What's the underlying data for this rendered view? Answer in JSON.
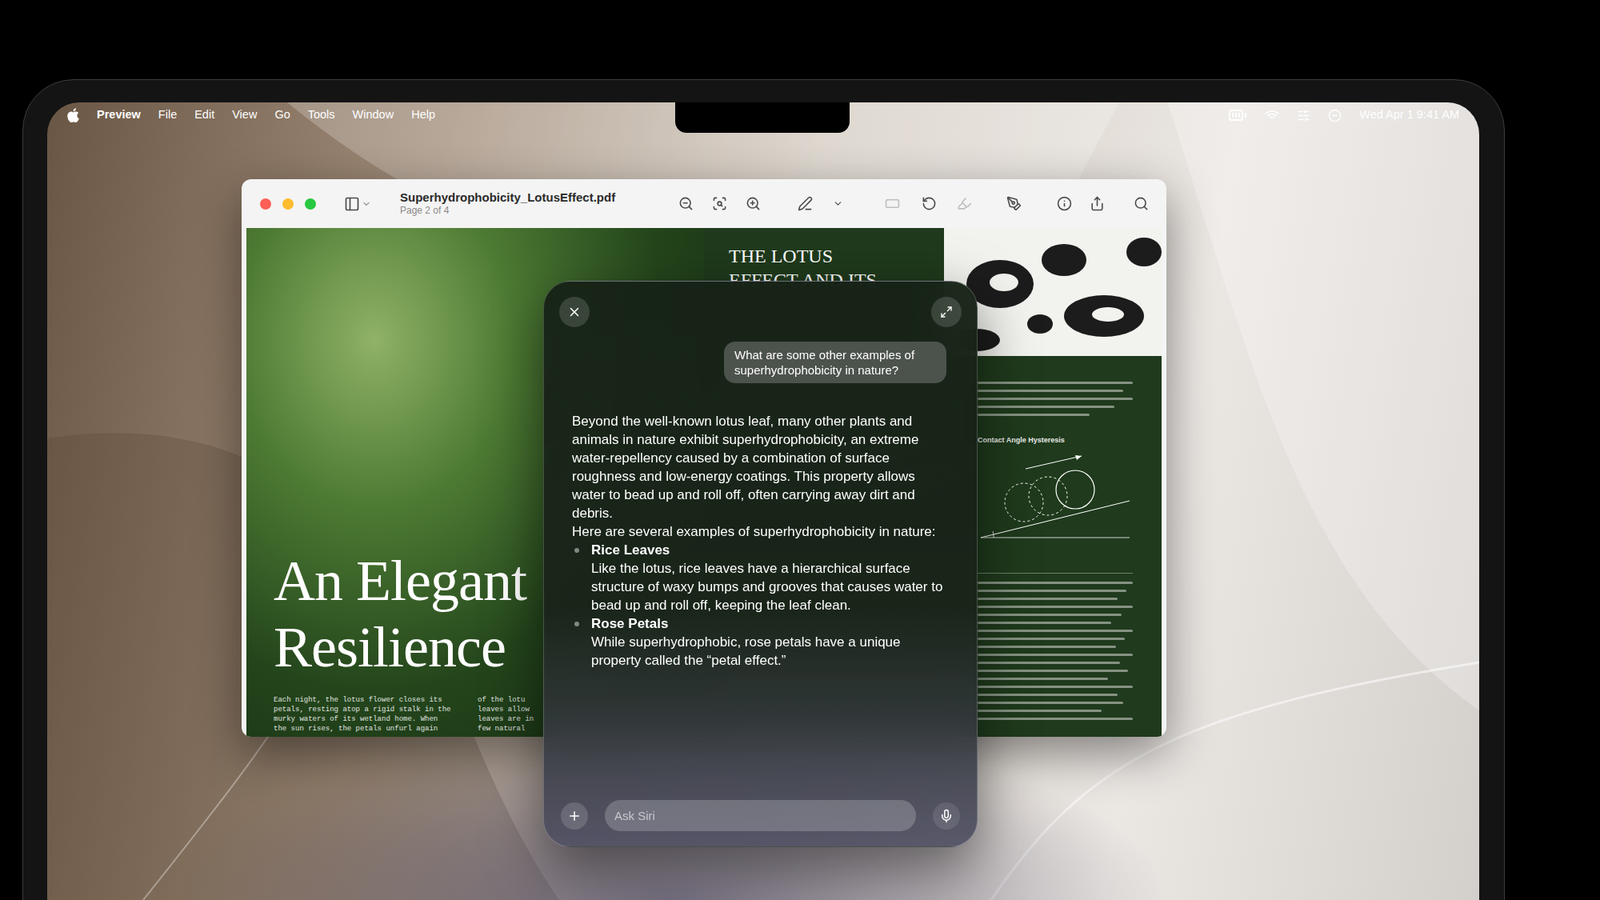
{
  "menu_bar": {
    "app": "Preview",
    "items": [
      "File",
      "Edit",
      "View",
      "Go",
      "Tools",
      "Window",
      "Help"
    ],
    "clock": "Wed Apr 1 9:41 AM"
  },
  "window": {
    "title": "Superhydrophobicity_LotusEffect.pdf",
    "subtitle": "Page 2 of 4",
    "toolbar": [
      {
        "disabled": false
      },
      {
        "disabled": false
      },
      {
        "disabled": false
      },
      {
        "disabled": false
      },
      {
        "disabled": false
      },
      {
        "disabled": true
      },
      {
        "disabled": false
      },
      {
        "disabled": true
      },
      {
        "disabled": false
      },
      {
        "disabled": false
      },
      {
        "disabled": false
      },
      {
        "disabled": false
      }
    ]
  },
  "document": {
    "left_page": {
      "title_lines": [
        "An Elegant",
        "Resilience"
      ],
      "body_columns": [
        [
          "Each night, the lotus flower closes its",
          "petals, resting atop a rigid stalk in the",
          "murky waters of its wetland home. When",
          "the sun rises, the petals unfurl again"
        ],
        [
          "of the lotu",
          "leaves allow",
          "leaves are in",
          "few natural"
        ]
      ]
    },
    "right_page": {
      "title_lines": [
        "THE LOTUS",
        "EFFECT AND ITS"
      ],
      "figure_caption": "Contact Angle Hysteresis"
    }
  },
  "siri": {
    "question": "What are some other examples of superhydrophobicity in nature?",
    "intro": "Beyond the well-known lotus leaf, many other plants and animals in nature exhibit superhydrophobicity, an extreme water-repellency caused by a combination of surface roughness and low-energy coatings. This property allows water to bead up and roll off, often carrying away dirt and debris.",
    "lead": "Here are several examples of superhydrophobicity in nature:",
    "examples": [
      {
        "name": "Rice Leaves",
        "text": "Like the lotus, rice leaves have a hierarchical surface structure of waxy bumps and grooves that causes water to bead up and roll off, keeping the leaf clean."
      },
      {
        "name": "Rose Petals",
        "text": "While superhydrophobic, rose petals have a unique property called the “petal effect.”"
      }
    ],
    "input_placeholder": "Ask Siri"
  }
}
